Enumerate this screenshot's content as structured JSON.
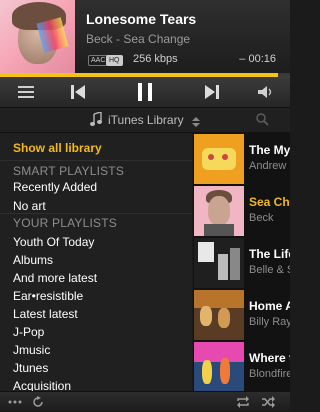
{
  "now_playing": {
    "title": "Lonesome Tears",
    "subtitle": "Beck - Sea Change",
    "format_badge": "AAC",
    "quality_badge": "HQ",
    "bitrate": "256 kbps",
    "remaining": "– 00:16",
    "progress_fraction": 0.96
  },
  "controls": {
    "menu_icon": "menu-icon",
    "prev_icon": "previous-track-icon",
    "pause_icon": "pause-icon",
    "next_icon": "next-track-icon",
    "volume_icon": "volume-icon"
  },
  "source": {
    "label": "iTunes Library"
  },
  "sidebar": {
    "show_all": "Show all library",
    "smart_header": "SMART PLAYLISTS",
    "smart_items": [
      "Recently Added",
      "No art"
    ],
    "your_header": "YOUR PLAYLISTS",
    "playlists": [
      "Youth Of Today",
      "Albums",
      "And more latest",
      "Ear•resistible",
      "Latest latest",
      "J-Pop",
      "Jmusic",
      "Jtunes",
      "Acquisition"
    ]
  },
  "albums": [
    {
      "title": "The Mys",
      "artist": "Andrew"
    },
    {
      "title": "Sea Cha",
      "artist": "Beck"
    },
    {
      "title": "The Life",
      "artist": "Belle & S"
    },
    {
      "title": "Home A",
      "artist": "Billy Ray"
    },
    {
      "title": "Where t",
      "artist": "Blondfire"
    }
  ],
  "colors": {
    "accent": "#f2b81c",
    "background": "#1b1b1b"
  }
}
